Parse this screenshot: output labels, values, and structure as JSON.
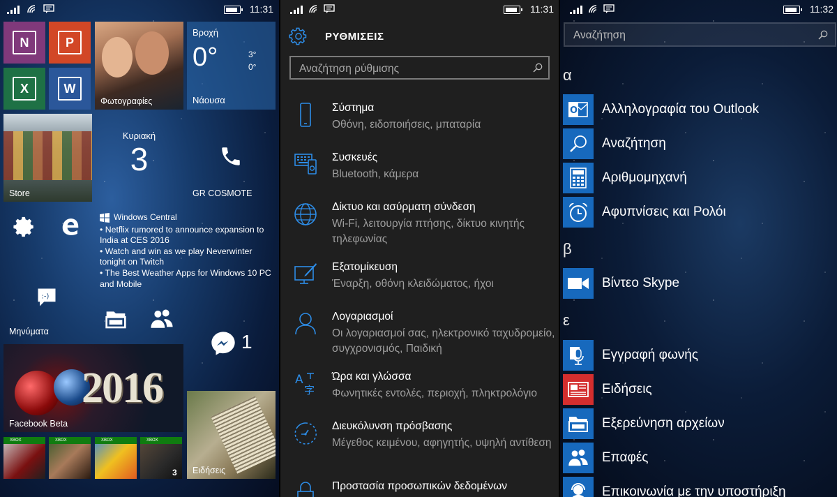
{
  "home": {
    "status": {
      "time": "11:31"
    },
    "tiles": {
      "onenote": "N",
      "powerpoint": "P",
      "excel": "X",
      "word": "W",
      "photos_label": "Φωτογραφίες",
      "weather_city": "Βροχή",
      "weather_temp": "0°",
      "weather_high": "3°",
      "weather_low": "0°",
      "weather_place": "Νάουσα",
      "store_label": "Store",
      "calendar_day": "Κυριακή",
      "calendar_date": "3",
      "phone_label": "GR COSMOTE",
      "messaging_label": "Μηνύματα",
      "messenger_count": "1",
      "facebook_label": "Facebook Beta",
      "year_art": "2016",
      "news_label": "Ειδήσεις",
      "xbox_band": "XBOX",
      "xbox_badge": "3"
    },
    "news_feed": {
      "source": "Windows Central",
      "items": [
        "• Netflix rumored to announce expansion to India at CES 2016",
        "• Watch and win as we play Neverwinter tonight on Twitch",
        "• The Best Weather Apps for Windows 10 PC and Mobile"
      ]
    }
  },
  "settings": {
    "status": {
      "time": "11:31"
    },
    "title": "ΡΥΘΜΙΣΕΙΣ",
    "search_placeholder": "Αναζήτηση ρύθμισης",
    "items": [
      {
        "title": "Σύστημα",
        "subtitle": "Οθόνη, ειδοποιήσεις, μπαταρία",
        "icon": "phone-icon"
      },
      {
        "title": "Συσκευές",
        "subtitle": "Bluetooth, κάμερα",
        "icon": "devices-icon"
      },
      {
        "title": "Δίκτυο και ασύρματη σύνδεση",
        "subtitle": "Wi-Fi, λειτουργία πτήσης, δίκτυο κινητής τηλεφωνίας",
        "icon": "globe-icon"
      },
      {
        "title": "Εξατομίκευση",
        "subtitle": "Έναρξη, οθόνη κλειδώματος, ήχοι",
        "icon": "personalization-icon"
      },
      {
        "title": "Λογαριασμοί",
        "subtitle": "Οι λογαριασμοί σας, ηλεκτρονικό ταχυδρομείο, συγχρονισμός, Παιδική",
        "icon": "person-icon"
      },
      {
        "title": "Ώρα και γλώσσα",
        "subtitle": "Φωνητικές εντολές, περιοχή, πληκτρολόγιο",
        "icon": "time-language-icon"
      },
      {
        "title": "Διευκόλυνση πρόσβασης",
        "subtitle": "Μέγεθος κειμένου, αφηγητής, υψηλή αντίθεση",
        "icon": "ease-of-access-icon"
      },
      {
        "title": "Προστασία προσωπικών δεδομένων",
        "subtitle": "",
        "icon": "lock-icon"
      }
    ]
  },
  "apps": {
    "status": {
      "time": "11:32"
    },
    "search_placeholder": "Αναζήτηση",
    "groups": [
      {
        "letter": "α",
        "apps": [
          "Αλληλογραφία του Outlook",
          "Αναζήτηση",
          "Αριθμομηχανή",
          "Αφυπνίσεις και Ρολόι"
        ]
      },
      {
        "letter": "β",
        "apps": [
          "Βίντεο Skype"
        ]
      },
      {
        "letter": "ε",
        "apps": [
          "Εγγραφή φωνής",
          "Ειδήσεις",
          "Εξερεύνηση αρχείων",
          "Επαφές",
          "Επικοινωνία με την υποστήριξη"
        ]
      }
    ]
  },
  "colors": {
    "accent": "#1769bd",
    "onenote": "#80397b",
    "powerpoint": "#d24726",
    "excel": "#1e7145",
    "word": "#2b579a",
    "news_red": "#d42e2e",
    "settings_bg": "#1f1f1f",
    "settings_icon": "#2d8ce6"
  }
}
